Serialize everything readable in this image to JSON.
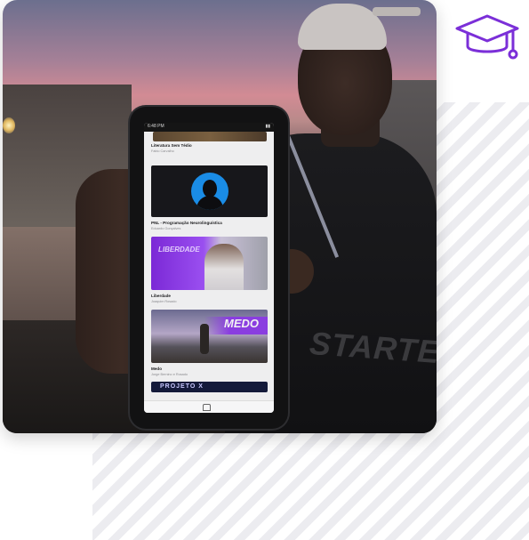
{
  "icon": {
    "name": "graduation-cap-icon",
    "color": "#7b2fd8"
  },
  "photo": {
    "description_icon": "photo",
    "phone_screen": {
      "status_time": "6:48 PM",
      "items": [
        {
          "title": "Literatura Sem Tédio",
          "subtitle": "Fabio Carvalho"
        },
        {
          "title": "PNL - Programação Neurolinguística",
          "subtitle": "Eduardo Gonçalves"
        },
        {
          "title": "Liberdade",
          "subtitle": "Joaquim Rosado"
        },
        {
          "title": "Medo",
          "subtitle": "Jorge Bernino e Rosado"
        }
      ],
      "banners": {
        "liberdade": "LIBERDADE",
        "medo": "MEDO",
        "projeto": "PROJETO X"
      }
    },
    "shirt_text": "STARTE"
  }
}
